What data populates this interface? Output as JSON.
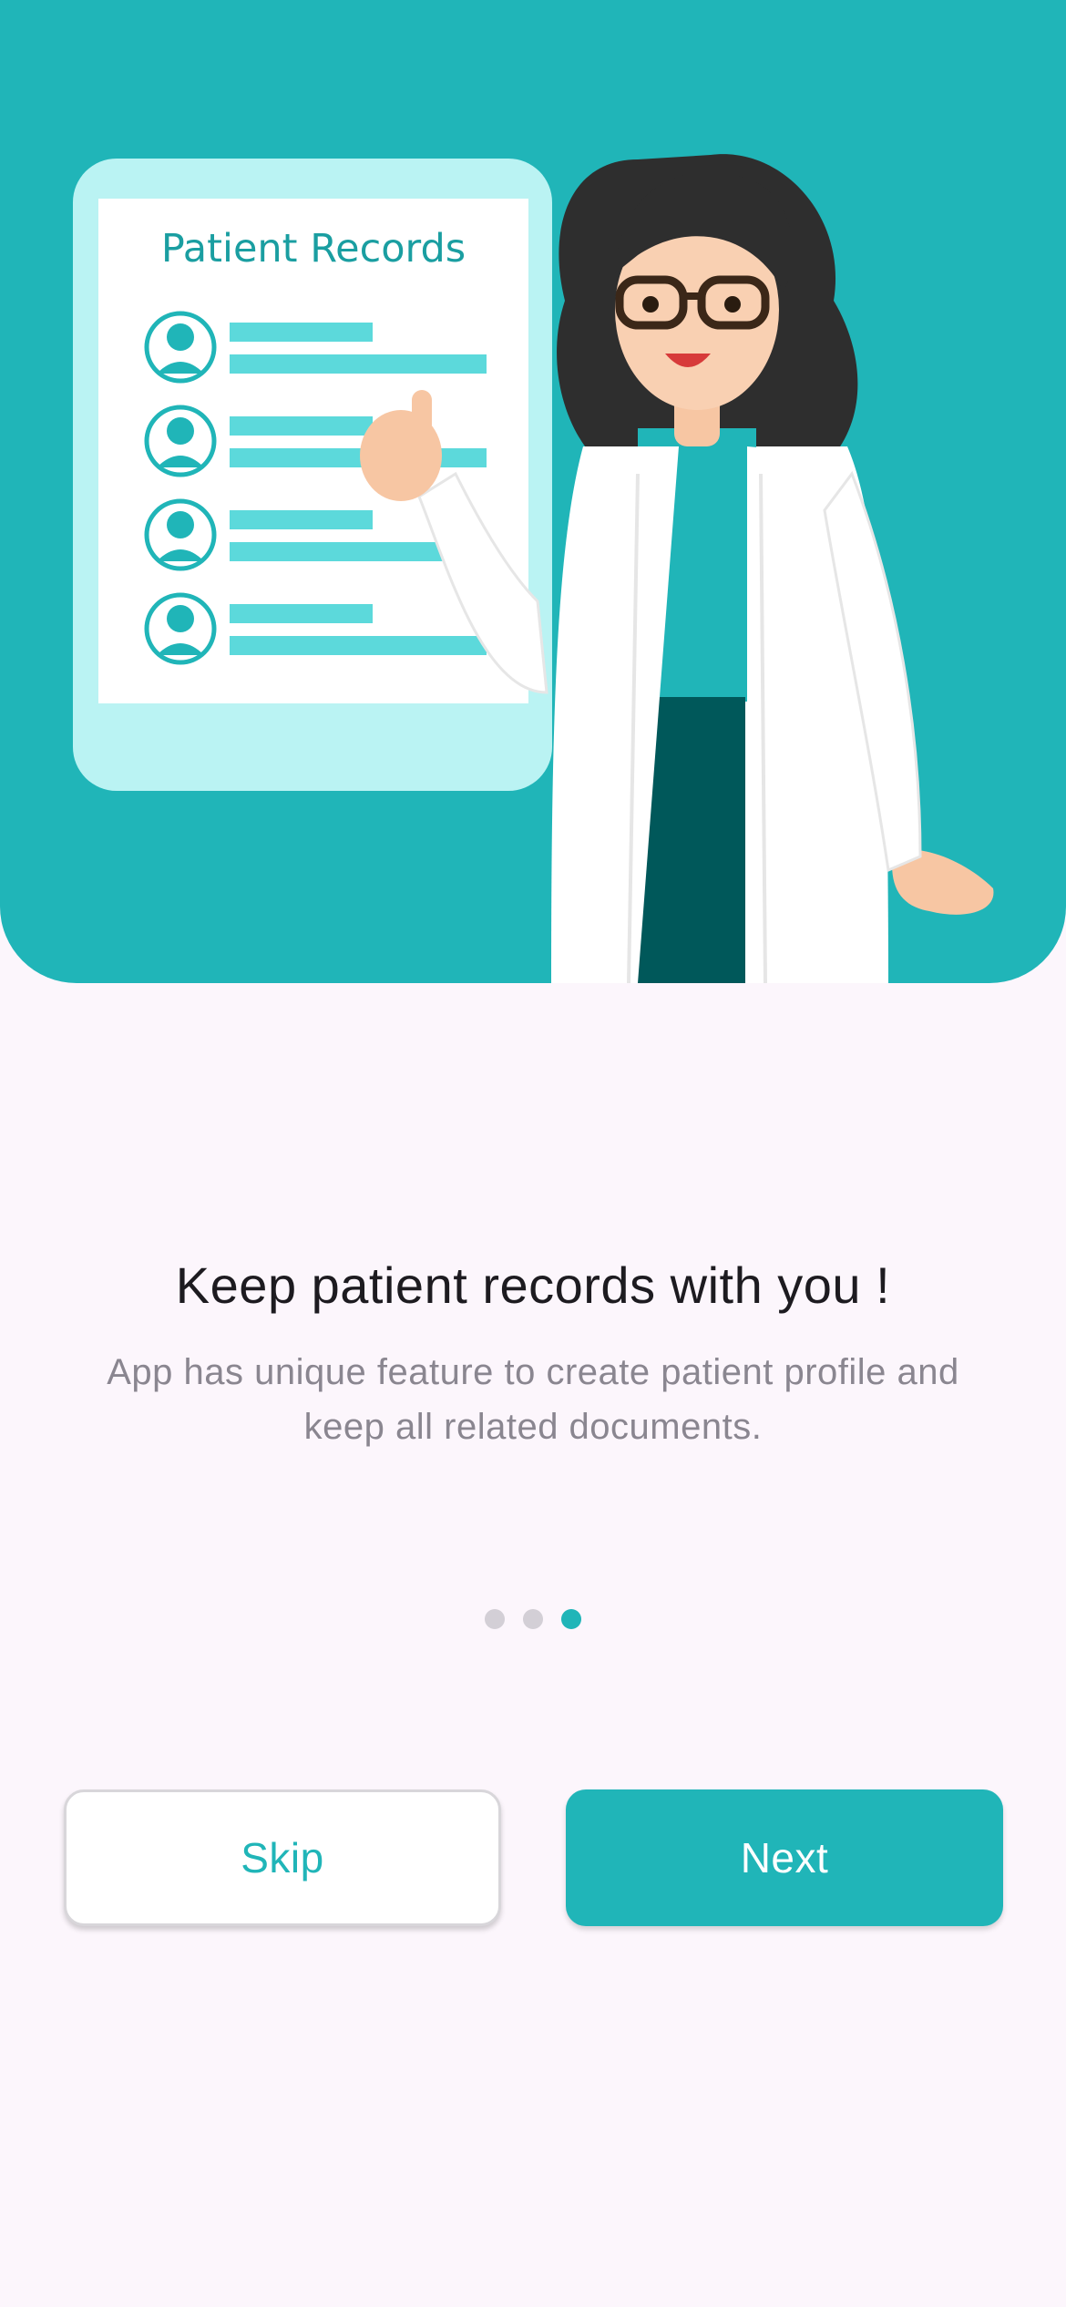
{
  "illustration": {
    "card_title": "Patient Records",
    "description_icon": "doctor-with-records-illustration"
  },
  "onboarding": {
    "headline": "Keep patient records with you !",
    "subtext": "App has unique feature to create patient profile and keep all related documents.",
    "page_indicator": {
      "total": 3,
      "current": 3
    }
  },
  "actions": {
    "skip_label": "Skip",
    "next_label": "Next"
  },
  "colors": {
    "accent": "#20b5b8",
    "background": "#fcf6fc"
  }
}
